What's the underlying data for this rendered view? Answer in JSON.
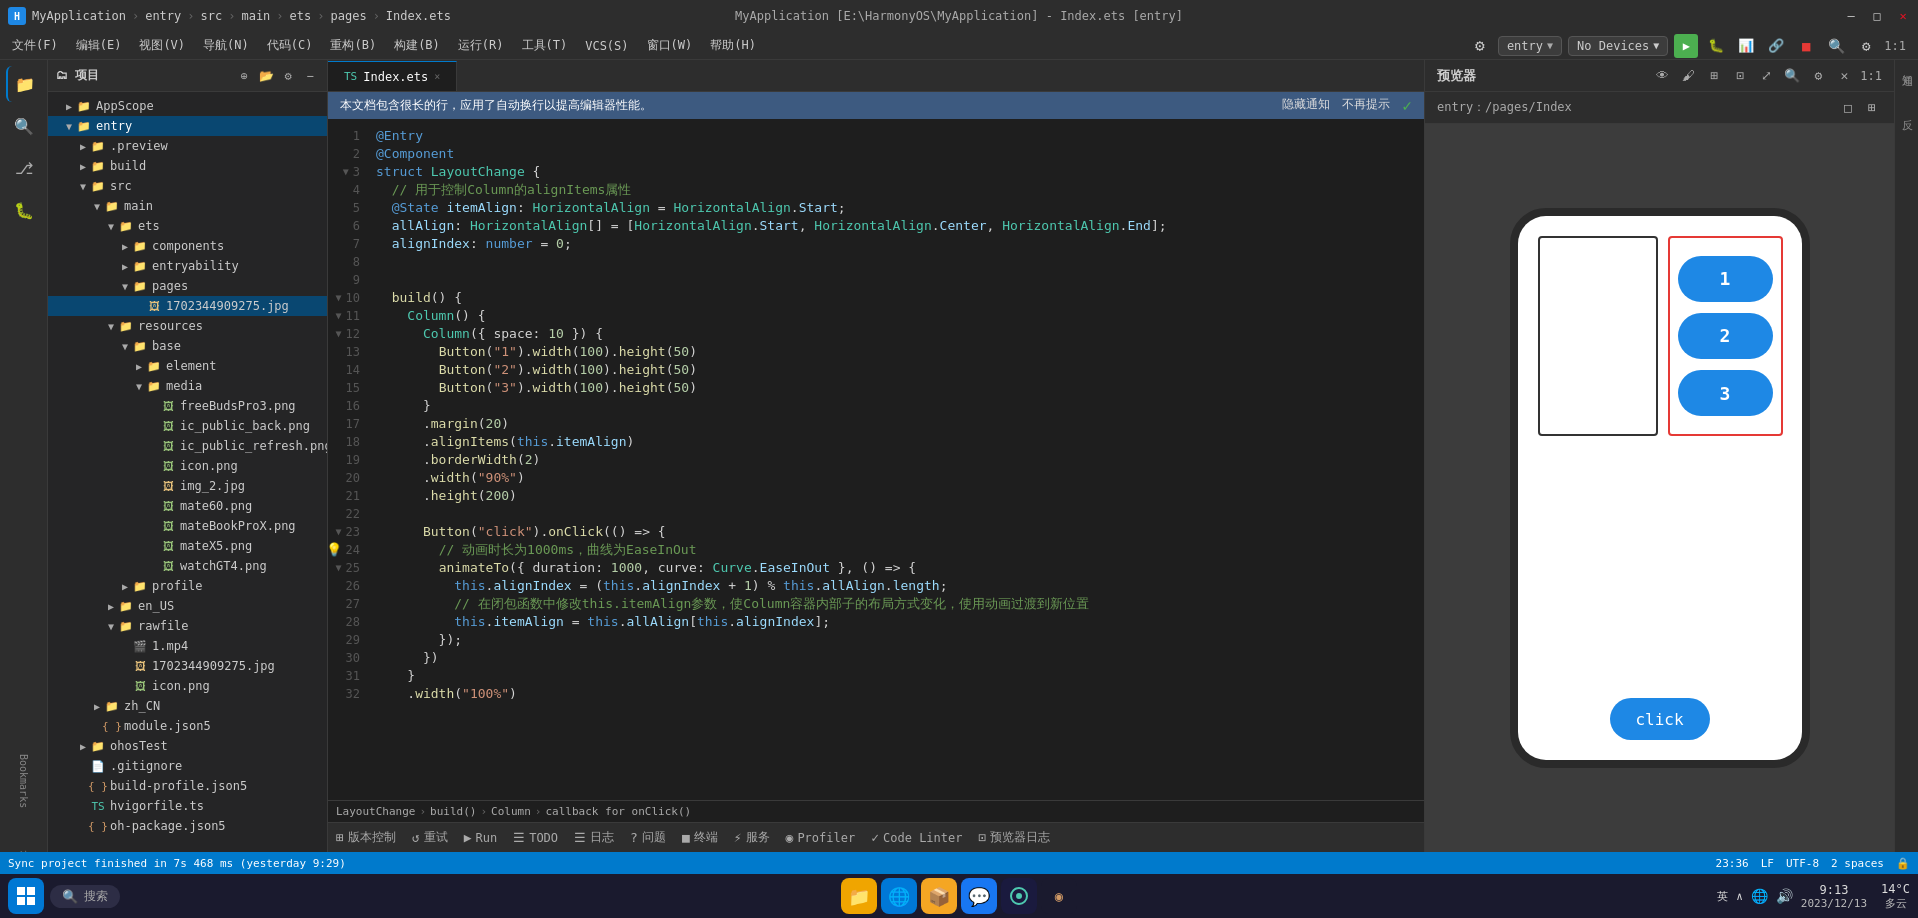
{
  "app": {
    "title": "MyApplication",
    "path": "MyApplication [E:\\HarmonyOS\\MyApplication] - Index.ets [entry]"
  },
  "titlebar": {
    "title": "MyApplication [E:\\HarmonyOS\\MyApplication] - Index.ets [entry]",
    "minimize": "—",
    "maximize": "□",
    "close": "✕"
  },
  "menubar": {
    "items": [
      "文件(F)",
      "编辑(E)",
      "视图(V)",
      "导航(N)",
      "代码(C)",
      "重构(B)",
      "构建(B)",
      "运行(R)",
      "工具(T)",
      "VCS(S)",
      "窗口(W)",
      "帮助(H)"
    ]
  },
  "toolbar": {
    "breadcrumb": [
      "MyApplication",
      "entry",
      "src",
      "main",
      "ets",
      "pages",
      "Index.ets"
    ]
  },
  "sidebar": {
    "title": "项目",
    "tree": [
      {
        "level": 0,
        "label": "AppScope",
        "type": "folder",
        "collapsed": false
      },
      {
        "level": 1,
        "label": "entry",
        "type": "folder-blue",
        "collapsed": false
      },
      {
        "level": 2,
        "label": ".preview",
        "type": "folder",
        "collapsed": true
      },
      {
        "level": 2,
        "label": "build",
        "type": "folder",
        "collapsed": true
      },
      {
        "level": 2,
        "label": "src",
        "type": "folder",
        "collapsed": false
      },
      {
        "level": 3,
        "label": "main",
        "type": "folder",
        "collapsed": false
      },
      {
        "level": 4,
        "label": "ets",
        "type": "folder",
        "collapsed": false
      },
      {
        "level": 5,
        "label": "components",
        "type": "folder",
        "collapsed": true
      },
      {
        "level": 5,
        "label": "entryability",
        "type": "folder",
        "collapsed": true
      },
      {
        "level": 5,
        "label": "pages",
        "type": "folder",
        "collapsed": false
      },
      {
        "level": 6,
        "label": "1702344909275.jpg",
        "type": "jpg",
        "selected": true
      },
      {
        "level": 4,
        "label": "resources",
        "type": "folder",
        "collapsed": false
      },
      {
        "level": 5,
        "label": "base",
        "type": "folder",
        "collapsed": false
      },
      {
        "level": 6,
        "label": "element",
        "type": "folder",
        "collapsed": true
      },
      {
        "level": 6,
        "label": "media",
        "type": "folder",
        "collapsed": false
      },
      {
        "level": 7,
        "label": "freeBudsPro3.png",
        "type": "png"
      },
      {
        "level": 7,
        "label": "ic_public_back.png",
        "type": "png"
      },
      {
        "level": 7,
        "label": "ic_public_refresh.png",
        "type": "png"
      },
      {
        "level": 7,
        "label": "icon.png",
        "type": "png"
      },
      {
        "level": 7,
        "label": "img_2.jpg",
        "type": "jpg"
      },
      {
        "level": 7,
        "label": "mate60.png",
        "type": "png"
      },
      {
        "level": 7,
        "label": "mateBookProX.png",
        "type": "png"
      },
      {
        "level": 7,
        "label": "mateX5.png",
        "type": "png"
      },
      {
        "level": 7,
        "label": "watchGT4.png",
        "type": "png"
      },
      {
        "level": 5,
        "label": "profile",
        "type": "folder",
        "collapsed": true
      },
      {
        "level": 4,
        "label": "en_US",
        "type": "folder",
        "collapsed": true
      },
      {
        "level": 4,
        "label": "rawfile",
        "type": "folder",
        "collapsed": false
      },
      {
        "level": 5,
        "label": "1.mp4",
        "type": "mp4"
      },
      {
        "level": 5,
        "label": "1702344909275.jpg",
        "type": "jpg"
      },
      {
        "level": 5,
        "label": "icon.png",
        "type": "png"
      },
      {
        "level": 3,
        "label": "zh_CN",
        "type": "folder",
        "collapsed": true
      },
      {
        "level": 3,
        "label": "module.json5",
        "type": "json"
      },
      {
        "level": 2,
        "label": "ohosTest",
        "type": "folder",
        "collapsed": true
      },
      {
        "level": 2,
        "label": ".gitignore",
        "type": "file"
      },
      {
        "level": 2,
        "label": "build-profile.json5",
        "type": "json"
      },
      {
        "level": 2,
        "label": "hvigorfile.ts",
        "type": "ts"
      },
      {
        "level": 2,
        "label": "oh-package.json5",
        "type": "json"
      }
    ]
  },
  "editor": {
    "tab": "Index.ets",
    "modified": true,
    "infobar": {
      "message": "本文档包含很长的行，应用了自动换行以提高编辑器性能。",
      "hide": "隐藏通知",
      "no_more": "不再提示"
    },
    "lines": [
      {
        "num": 1,
        "code": "@Entry"
      },
      {
        "num": 2,
        "code": "@Component"
      },
      {
        "num": 3,
        "code": "struct LayoutChange {"
      },
      {
        "num": 4,
        "code": "  // 用于控制Column的alignItems属性"
      },
      {
        "num": 5,
        "code": "  @State itemAlign: HorizontalAlign = HorizontalAlign.Start;"
      },
      {
        "num": 6,
        "code": "  allAlign: HorizontalAlign[] = [HorizontalAlign.Start, HorizontalAlign.Center, HorizontalAlign.End];"
      },
      {
        "num": 7,
        "code": "  alignIndex: number = 0;"
      },
      {
        "num": 8,
        "code": ""
      },
      {
        "num": 9,
        "code": ""
      },
      {
        "num": 10,
        "code": "  build() {"
      },
      {
        "num": 11,
        "code": "    Column() {"
      },
      {
        "num": 12,
        "code": "      Column({ space: 10 }) {"
      },
      {
        "num": 13,
        "code": "        Button(\"1\").width(100).height(50)"
      },
      {
        "num": 14,
        "code": "        Button(\"2\").width(100).height(50)"
      },
      {
        "num": 15,
        "code": "        Button(\"3\").width(100).height(50)"
      },
      {
        "num": 16,
        "code": "      }"
      },
      {
        "num": 17,
        "code": "      .margin(20)"
      },
      {
        "num": 18,
        "code": "      .alignItems(this.itemAlign)"
      },
      {
        "num": 19,
        "code": "      .borderWidth(2)"
      },
      {
        "num": 20,
        "code": "      .width(\"90%\")"
      },
      {
        "num": 21,
        "code": "      .height(200)"
      },
      {
        "num": 22,
        "code": ""
      },
      {
        "num": 23,
        "code": "      Button(\"click\").onClick(() => {",
        "hint": true
      },
      {
        "num": 24,
        "code": "        // 动画时长为1000ms，曲线为EaseInOut",
        "lightbulb": true
      },
      {
        "num": 25,
        "code": "        animateTo({ duration: 1000, curve: Curve.EaseInOut }, () => {"
      },
      {
        "num": 26,
        "code": "          this.alignIndex = (this.alignIndex + 1) % this.allAlign.length;"
      },
      {
        "num": 27,
        "code": "          // 在闭包函数中修改this.itemAlign参数，使Column容器内部子的布局方式变化，使用动画过渡到新位置"
      },
      {
        "num": 28,
        "code": "          this.itemAlign = this.allAlign[this.alignIndex];"
      },
      {
        "num": 29,
        "code": "        });"
      },
      {
        "num": 30,
        "code": "      })"
      },
      {
        "num": 31,
        "code": "    }"
      },
      {
        "num": 32,
        "code": "    .width(\"100%\")"
      }
    ],
    "breadcrumb": [
      "LayoutChange",
      "build()",
      "Column",
      "callback for onClick()"
    ]
  },
  "preview": {
    "title": "预览器",
    "path": "entry：/pages/Index",
    "buttons": [
      "1",
      "2",
      "3"
    ],
    "click_button": "click"
  },
  "bottom_toolbar": {
    "items": [
      {
        "icon": "⊞",
        "label": "版本控制"
      },
      {
        "icon": "↺",
        "label": "重试"
      },
      {
        "icon": "▶",
        "label": "Run"
      },
      {
        "icon": "☰",
        "label": "TODO"
      },
      {
        "icon": "☰",
        "label": "日志"
      },
      {
        "icon": "?",
        "label": "问题"
      },
      {
        "icon": "■",
        "label": "终端"
      },
      {
        "icon": "⚡",
        "label": "服务"
      },
      {
        "icon": "◉",
        "label": "Profiler"
      },
      {
        "icon": "✓",
        "label": "Code Linter"
      },
      {
        "icon": "⊡",
        "label": "预览器日志"
      }
    ]
  },
  "statusbar": {
    "left": "Sync project finished in 7s 468 ms (yesterday 9:29)",
    "position": "23:36",
    "encoding": "LF",
    "charset": "UTF-8",
    "indent": "2 spaces",
    "right_icon": "🔒"
  },
  "taskbar": {
    "time": "9:13",
    "date": "2023/12/13",
    "temperature": "14°C",
    "location": "多云",
    "search_placeholder": "搜索",
    "apps": [
      "⊞",
      "📁",
      "🌐",
      "💼",
      "🎵",
      "💎"
    ],
    "sys_tray": [
      "英",
      "∧",
      "⊕",
      "🔊"
    ]
  },
  "devices_label": "Devices",
  "no_devices": "No Devices"
}
